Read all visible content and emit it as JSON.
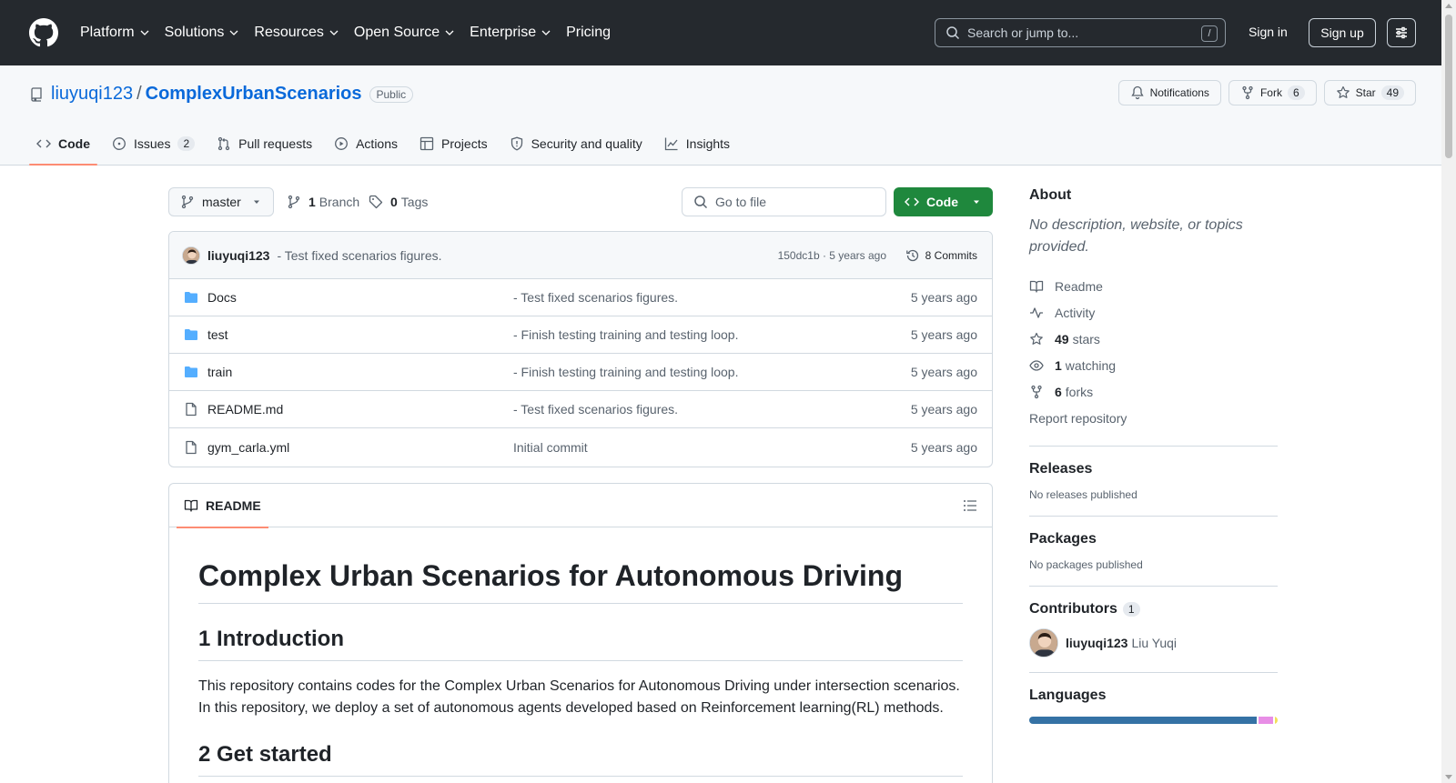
{
  "header": {
    "nav": [
      {
        "label": "Platform",
        "dropdown": true
      },
      {
        "label": "Solutions",
        "dropdown": true
      },
      {
        "label": "Resources",
        "dropdown": true
      },
      {
        "label": "Open Source",
        "dropdown": true
      },
      {
        "label": "Enterprise",
        "dropdown": true
      },
      {
        "label": "Pricing",
        "dropdown": false
      }
    ],
    "search_placeholder": "Search or jump to...",
    "search_shortcut": "/",
    "signin": "Sign in",
    "signup": "Sign up"
  },
  "repo": {
    "owner": "liuyuqi123",
    "separator": "/",
    "name": "ComplexUrbanScenarios",
    "visibility": "Public",
    "notifications_label": "Notifications",
    "fork_label": "Fork",
    "fork_count": "6",
    "star_label": "Star",
    "star_count": "49",
    "tabs": [
      {
        "label": "Code",
        "icon": "code-icon",
        "active": true,
        "count": ""
      },
      {
        "label": "Issues",
        "icon": "issue-icon",
        "active": false,
        "count": "2"
      },
      {
        "label": "Pull requests",
        "icon": "pull-request-icon",
        "active": false,
        "count": ""
      },
      {
        "label": "Actions",
        "icon": "play-icon",
        "active": false,
        "count": ""
      },
      {
        "label": "Projects",
        "icon": "table-icon",
        "active": false,
        "count": ""
      },
      {
        "label": "Security and quality",
        "icon": "shield-icon",
        "active": false,
        "count": ""
      },
      {
        "label": "Insights",
        "icon": "graph-icon",
        "active": false,
        "count": ""
      }
    ]
  },
  "toolbar": {
    "branch": "master",
    "branch_count": "1",
    "branch_label": "Branch",
    "tag_count": "0",
    "tag_label": "Tags",
    "goto_placeholder": "Go to file",
    "code_button": "Code"
  },
  "commit": {
    "author": "liuyuqi123",
    "message": "- Test fixed scenarios figures.",
    "hash_age": "150dc1b · 5 years ago",
    "count_label": "8 Commits"
  },
  "files": [
    {
      "name": "Docs",
      "type": "folder",
      "message": "- Test fixed scenarios figures.",
      "age": "5 years ago"
    },
    {
      "name": "test",
      "type": "folder",
      "message": "- Finish testing training and testing loop.",
      "age": "5 years ago"
    },
    {
      "name": "train",
      "type": "folder",
      "message": "- Finish testing training and testing loop.",
      "age": "5 years ago"
    },
    {
      "name": "README.md",
      "type": "file",
      "message": "- Test fixed scenarios figures.",
      "age": "5 years ago"
    },
    {
      "name": "gym_carla.yml",
      "type": "file",
      "message": "Initial commit",
      "age": "5 years ago"
    }
  ],
  "readme": {
    "tab_label": "README",
    "h1": "Complex Urban Scenarios for Autonomous Driving",
    "h2_intro": "1 Introduction",
    "p_intro": "This repository contains codes for the Complex Urban Scenarios for Autonomous Driving under intersection scenarios. In this repository, we deploy a set of autonomous agents developed based on Reinforcement learning(RL) methods.",
    "h2_start": "2 Get started"
  },
  "sidebar": {
    "about_title": "About",
    "description": "No description, website, or topics provided.",
    "readme_link": "Readme",
    "activity_link": "Activity",
    "stars_count": "49",
    "stars_label": "stars",
    "watching_count": "1",
    "watching_label": "watching",
    "forks_count": "6",
    "forks_label": "forks",
    "report_link": "Report repository",
    "releases_title": "Releases",
    "releases_text": "No releases published",
    "packages_title": "Packages",
    "packages_text": "No packages published",
    "contributors_title": "Contributors",
    "contributors_count": "1",
    "contributor_login": "liuyuqi123",
    "contributor_name": "Liu Yuqi",
    "languages_title": "Languages",
    "languages": [
      {
        "share": 0.93,
        "color": "#3572A5"
      },
      {
        "share": 0.06,
        "color": "#e88ee6"
      },
      {
        "share": 0.01,
        "color": "#f1e05a"
      }
    ]
  }
}
